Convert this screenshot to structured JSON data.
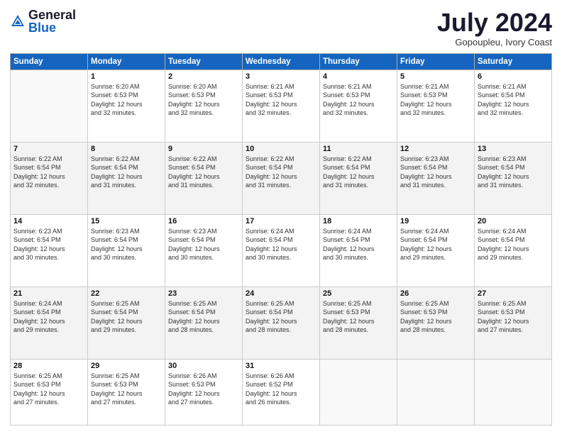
{
  "logo": {
    "general": "General",
    "blue": "Blue"
  },
  "header": {
    "title": "July 2024",
    "subtitle": "Gopoupleu, Ivory Coast"
  },
  "weekdays": [
    "Sunday",
    "Monday",
    "Tuesday",
    "Wednesday",
    "Thursday",
    "Friday",
    "Saturday"
  ],
  "weeks": [
    [
      {
        "day": "",
        "info": ""
      },
      {
        "day": "1",
        "info": "Sunrise: 6:20 AM\nSunset: 6:53 PM\nDaylight: 12 hours\nand 32 minutes."
      },
      {
        "day": "2",
        "info": "Sunrise: 6:20 AM\nSunset: 6:53 PM\nDaylight: 12 hours\nand 32 minutes."
      },
      {
        "day": "3",
        "info": "Sunrise: 6:21 AM\nSunset: 6:53 PM\nDaylight: 12 hours\nand 32 minutes."
      },
      {
        "day": "4",
        "info": "Sunrise: 6:21 AM\nSunset: 6:53 PM\nDaylight: 12 hours\nand 32 minutes."
      },
      {
        "day": "5",
        "info": "Sunrise: 6:21 AM\nSunset: 6:53 PM\nDaylight: 12 hours\nand 32 minutes."
      },
      {
        "day": "6",
        "info": "Sunrise: 6:21 AM\nSunset: 6:54 PM\nDaylight: 12 hours\nand 32 minutes."
      }
    ],
    [
      {
        "day": "7",
        "info": "Sunrise: 6:22 AM\nSunset: 6:54 PM\nDaylight: 12 hours\nand 32 minutes."
      },
      {
        "day": "8",
        "info": "Sunrise: 6:22 AM\nSunset: 6:54 PM\nDaylight: 12 hours\nand 31 minutes."
      },
      {
        "day": "9",
        "info": "Sunrise: 6:22 AM\nSunset: 6:54 PM\nDaylight: 12 hours\nand 31 minutes."
      },
      {
        "day": "10",
        "info": "Sunrise: 6:22 AM\nSunset: 6:54 PM\nDaylight: 12 hours\nand 31 minutes."
      },
      {
        "day": "11",
        "info": "Sunrise: 6:22 AM\nSunset: 6:54 PM\nDaylight: 12 hours\nand 31 minutes."
      },
      {
        "day": "12",
        "info": "Sunrise: 6:23 AM\nSunset: 6:54 PM\nDaylight: 12 hours\nand 31 minutes."
      },
      {
        "day": "13",
        "info": "Sunrise: 6:23 AM\nSunset: 6:54 PM\nDaylight: 12 hours\nand 31 minutes."
      }
    ],
    [
      {
        "day": "14",
        "info": "Sunrise: 6:23 AM\nSunset: 6:54 PM\nDaylight: 12 hours\nand 30 minutes."
      },
      {
        "day": "15",
        "info": "Sunrise: 6:23 AM\nSunset: 6:54 PM\nDaylight: 12 hours\nand 30 minutes."
      },
      {
        "day": "16",
        "info": "Sunrise: 6:23 AM\nSunset: 6:54 PM\nDaylight: 12 hours\nand 30 minutes."
      },
      {
        "day": "17",
        "info": "Sunrise: 6:24 AM\nSunset: 6:54 PM\nDaylight: 12 hours\nand 30 minutes."
      },
      {
        "day": "18",
        "info": "Sunrise: 6:24 AM\nSunset: 6:54 PM\nDaylight: 12 hours\nand 30 minutes."
      },
      {
        "day": "19",
        "info": "Sunrise: 6:24 AM\nSunset: 6:54 PM\nDaylight: 12 hours\nand 29 minutes."
      },
      {
        "day": "20",
        "info": "Sunrise: 6:24 AM\nSunset: 6:54 PM\nDaylight: 12 hours\nand 29 minutes."
      }
    ],
    [
      {
        "day": "21",
        "info": "Sunrise: 6:24 AM\nSunset: 6:54 PM\nDaylight: 12 hours\nand 29 minutes."
      },
      {
        "day": "22",
        "info": "Sunrise: 6:25 AM\nSunset: 6:54 PM\nDaylight: 12 hours\nand 29 minutes."
      },
      {
        "day": "23",
        "info": "Sunrise: 6:25 AM\nSunset: 6:54 PM\nDaylight: 12 hours\nand 28 minutes."
      },
      {
        "day": "24",
        "info": "Sunrise: 6:25 AM\nSunset: 6:54 PM\nDaylight: 12 hours\nand 28 minutes."
      },
      {
        "day": "25",
        "info": "Sunrise: 6:25 AM\nSunset: 6:53 PM\nDaylight: 12 hours\nand 28 minutes."
      },
      {
        "day": "26",
        "info": "Sunrise: 6:25 AM\nSunset: 6:53 PM\nDaylight: 12 hours\nand 28 minutes."
      },
      {
        "day": "27",
        "info": "Sunrise: 6:25 AM\nSunset: 6:53 PM\nDaylight: 12 hours\nand 27 minutes."
      }
    ],
    [
      {
        "day": "28",
        "info": "Sunrise: 6:25 AM\nSunset: 6:53 PM\nDaylight: 12 hours\nand 27 minutes."
      },
      {
        "day": "29",
        "info": "Sunrise: 6:25 AM\nSunset: 6:53 PM\nDaylight: 12 hours\nand 27 minutes."
      },
      {
        "day": "30",
        "info": "Sunrise: 6:26 AM\nSunset: 6:53 PM\nDaylight: 12 hours\nand 27 minutes."
      },
      {
        "day": "31",
        "info": "Sunrise: 6:26 AM\nSunset: 6:52 PM\nDaylight: 12 hours\nand 26 minutes."
      },
      {
        "day": "",
        "info": ""
      },
      {
        "day": "",
        "info": ""
      },
      {
        "day": "",
        "info": ""
      }
    ]
  ]
}
